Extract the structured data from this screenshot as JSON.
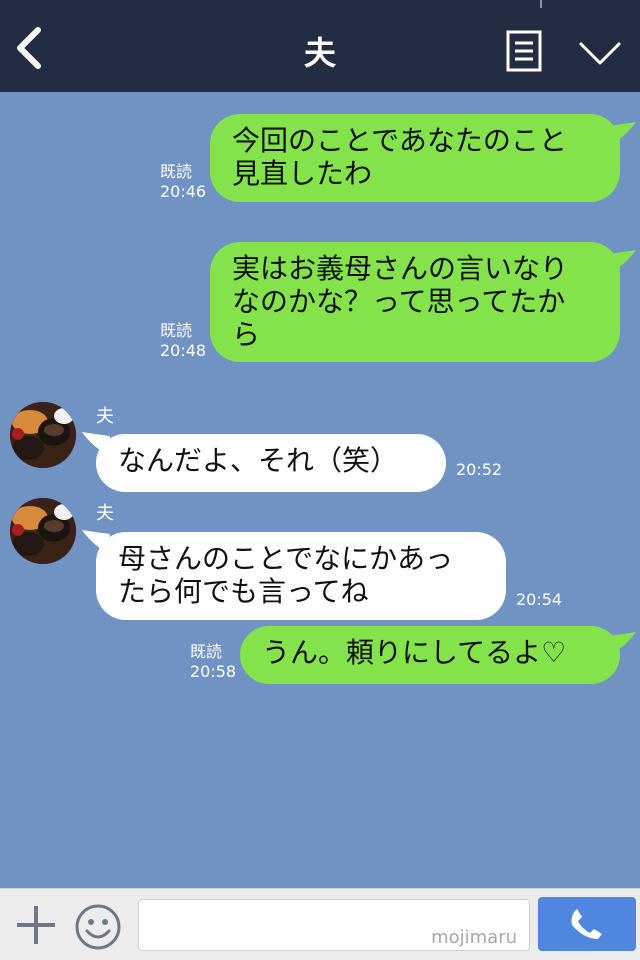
{
  "header": {
    "title": "夫"
  },
  "messages": [
    {
      "lines": [
        "今回のことであなたのこと",
        "見直したわ"
      ],
      "read": "既読",
      "time": "20:46"
    },
    {
      "lines": [
        "実はお義母さんの言いなり",
        "なのかな？って思ってたか",
        "ら"
      ],
      "read": "既読",
      "time": "20:48"
    },
    {
      "sender": "夫",
      "lines": [
        "なんだよ、それ（笑）"
      ],
      "time": "20:52"
    },
    {
      "sender": "夫",
      "lines": [
        "母さんのことでなにかあっ",
        "たら何でも言ってね"
      ],
      "time": "20:54"
    },
    {
      "lines": [
        "うん。頼りにしてるよ♡"
      ],
      "read": "既読",
      "time": "20:58"
    }
  ],
  "input": {
    "watermark": "mojimaru"
  },
  "colors": {
    "header_bg": "#232c42",
    "chat_bg": "#7093c3",
    "outgoing_bubble": "#84e24a",
    "incoming_bubble": "#ffffff",
    "send_button": "#4f87e0"
  }
}
